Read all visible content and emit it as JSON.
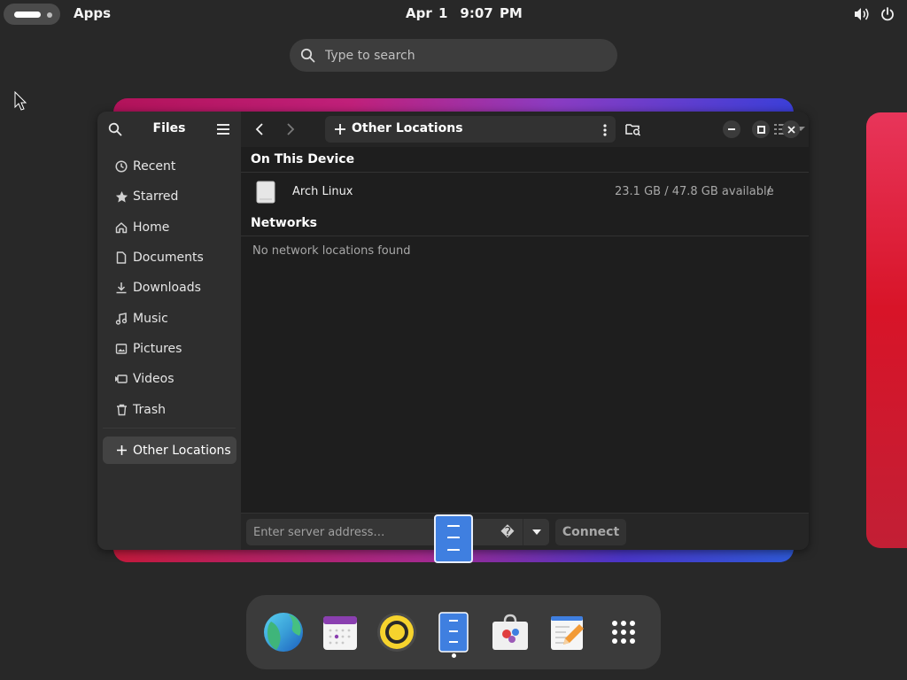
{
  "topbar": {
    "activities_icon": "activities-pill-icon",
    "apps_label": "Apps",
    "date": "Apr 1",
    "time": "9:07 PM",
    "tray_icons": [
      "volume-icon",
      "power-icon"
    ]
  },
  "search": {
    "placeholder": "Type to search",
    "icon": "search-icon"
  },
  "window": {
    "title": "Files",
    "sidebar": {
      "items": [
        {
          "label": "Recent",
          "icon": "clock-icon"
        },
        {
          "label": "Starred",
          "icon": "star-icon"
        },
        {
          "label": "Home",
          "icon": "home-icon"
        },
        {
          "label": "Documents",
          "icon": "document-icon"
        },
        {
          "label": "Downloads",
          "icon": "download-icon"
        },
        {
          "label": "Music",
          "icon": "music-icon"
        },
        {
          "label": "Pictures",
          "icon": "picture-icon"
        },
        {
          "label": "Videos",
          "icon": "video-icon"
        },
        {
          "label": "Trash",
          "icon": "trash-icon"
        }
      ],
      "other_locations": {
        "label": "Other Locations",
        "icon": "plus-icon",
        "selected": true
      }
    },
    "toolbar": {
      "path_label": "Other Locations"
    },
    "main": {
      "section_device": "On This Device",
      "device": {
        "name": "Arch Linux",
        "space": "23.1 GB / 47.8 GB available",
        "mount": "/",
        "icon": "drive-icon"
      },
      "section_networks": "Networks",
      "empty_networks": "No network locations found"
    },
    "bottom": {
      "server_placeholder": "Enter server address…",
      "help_glyph": "�",
      "connect_label": "Connect"
    }
  },
  "dock": {
    "apps": [
      "web-browser-icon",
      "calendar-icon",
      "rhythmbox-icon",
      "files-icon",
      "software-icon",
      "text-editor-icon",
      "app-grid-icon"
    ],
    "active": "files-icon"
  },
  "colors": {
    "accent": "#3f7fe0",
    "background": "#282828",
    "window": "#1e1e1e",
    "sidebar": "#2e2e2e"
  }
}
